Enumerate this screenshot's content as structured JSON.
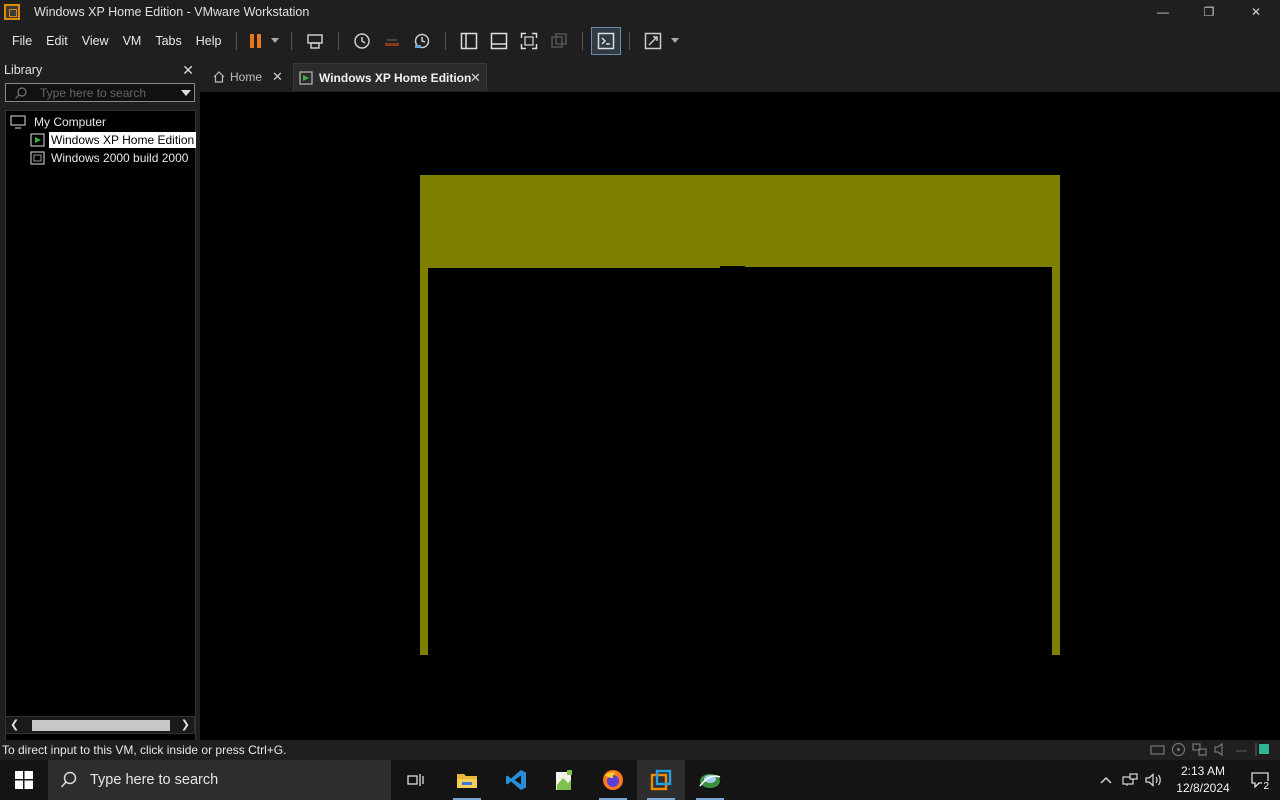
{
  "window": {
    "title": "Windows XP Home Edition - VMware Workstation",
    "minimize_glyph": "—",
    "maximize_glyph": "❐",
    "close_glyph": "✕"
  },
  "menu": {
    "items": [
      "File",
      "Edit",
      "View",
      "VM",
      "Tabs",
      "Help"
    ]
  },
  "toolbar": {
    "icons": [
      "pause-icon",
      "send-ctrl-alt-del-icon",
      "snapshot-icon",
      "revert-snapshot-icon",
      "snapshot-manager-icon",
      "show-library-icon",
      "show-thumbnail-bar-icon",
      "full-screen-icon",
      "unity-icon",
      "console-view-icon",
      "stretch-guest-icon"
    ],
    "accent_color": "#e8761e"
  },
  "library": {
    "title": "Library",
    "search_placeholder": "Type here to search",
    "tree": [
      {
        "label": "My Computer",
        "level": 0,
        "selected": false
      },
      {
        "label": "Windows XP Home Edition",
        "level": 1,
        "selected": true
      },
      {
        "label": "Windows 2000 build 2000",
        "level": 1,
        "selected": false
      }
    ]
  },
  "tabs": [
    {
      "label": "Home",
      "active": false
    },
    {
      "label": "Windows XP Home Edition",
      "active": true
    }
  ],
  "vm_screen": {
    "frame_color": "#808000",
    "background": "#000000"
  },
  "status": {
    "text": "To direct input to this VM, click inside or press Ctrl+G."
  },
  "taskbar": {
    "search_text": "Type here to search",
    "apps": [
      "task-view-icon",
      "file-explorer-icon",
      "vscode-icon",
      "notepad-plus-icon",
      "firefox-icon",
      "vmware-icon",
      "network-app-icon"
    ],
    "time": "2:13 AM",
    "date": "12/8/2024",
    "notification_count": "2"
  }
}
